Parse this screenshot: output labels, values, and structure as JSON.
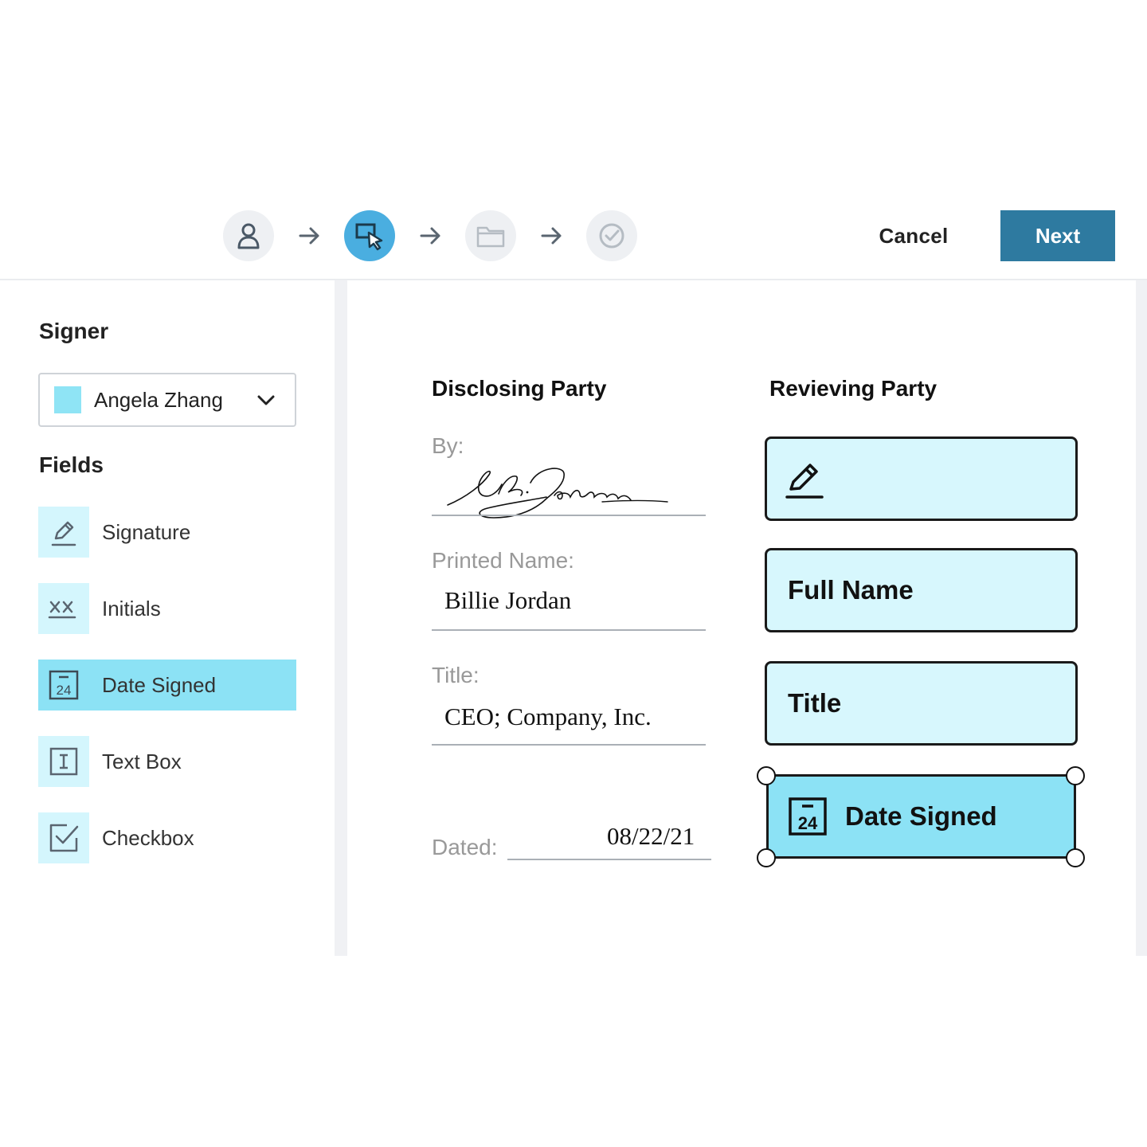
{
  "stepper": {
    "steps": [
      {
        "icon": "user-icon",
        "state": "inactive"
      },
      {
        "icon": "select-field-icon",
        "state": "active"
      },
      {
        "icon": "folder-icon",
        "state": "inactive"
      },
      {
        "icon": "check-circle-icon",
        "state": "inactive"
      }
    ]
  },
  "toolbar": {
    "cancel_label": "Cancel",
    "next_label": "Next"
  },
  "colors": {
    "accent": "#4aaee0",
    "primary_button": "#2e7aa0",
    "field_fill": "#d7f7fd",
    "field_selected": "#8ce2f5"
  },
  "sidebar": {
    "signer_heading": "Signer",
    "signer_selected": "Angela Zhang",
    "fields_heading": "Fields",
    "fields": [
      {
        "label": "Signature",
        "icon": "pen-icon"
      },
      {
        "label": "Initials",
        "icon": "initials-icon"
      },
      {
        "label": "Date Signed",
        "icon": "calendar-icon",
        "selected": true
      },
      {
        "label": "Text Box",
        "icon": "text-cursor-icon"
      },
      {
        "label": "Checkbox",
        "icon": "checkbox-icon"
      }
    ]
  },
  "document": {
    "disclosing_heading": "Disclosing Party",
    "receiving_heading": "Revieving Party",
    "by_label": "By:",
    "printed_name_label": "Printed Name:",
    "printed_name_value": "Billie Jordan",
    "title_label": "Title:",
    "title_value": "CEO; Company, Inc.",
    "dated_label": "Dated:",
    "dated_value": "08/22/21",
    "signature_text": "B. Jordan"
  },
  "placed_fields": {
    "signature_icon": "pen-icon",
    "full_name": "Full Name",
    "title": "Title",
    "date_signed": "Date Signed"
  }
}
